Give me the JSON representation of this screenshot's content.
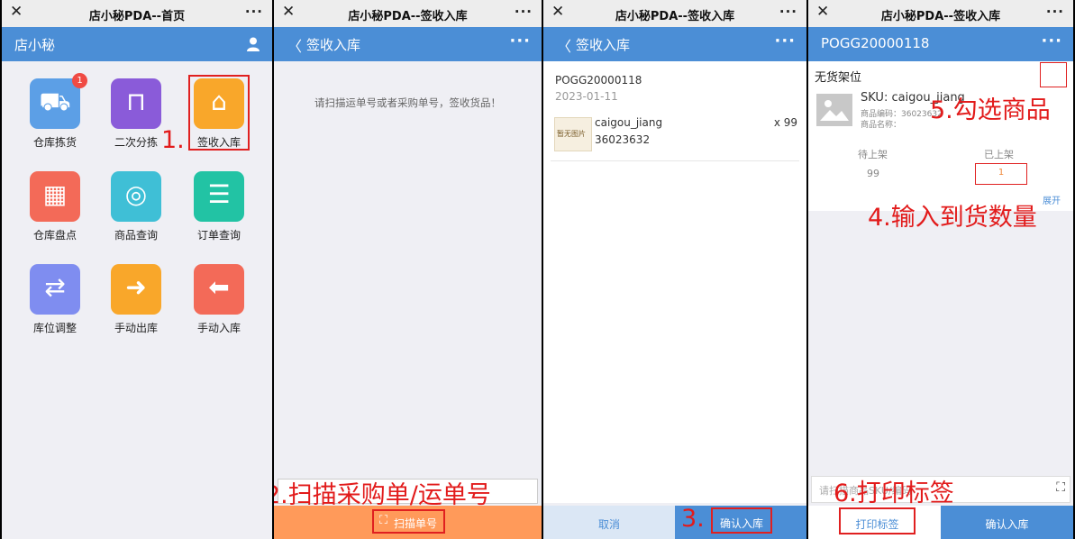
{
  "wechat": {
    "close_glyph": "✕",
    "more_glyph": "···"
  },
  "panel1": {
    "wechat_title": "店小秘PDA--首页",
    "header_title": "店小秘",
    "apps": [
      {
        "label": "仓库拣货",
        "icon": "cart-icon",
        "color": "#5c9fe6",
        "badge": "1",
        "glyph": "⛟"
      },
      {
        "label": "二次分拣",
        "icon": "sort-doc-icon",
        "color": "#8a5bd9",
        "glyph": "⊓"
      },
      {
        "label": "签收入库",
        "icon": "house-in-icon",
        "color": "#f9a72a",
        "glyph": "⌂"
      },
      {
        "label": "仓库盘点",
        "icon": "calculator-icon",
        "color": "#f36a58",
        "glyph": "▦"
      },
      {
        "label": "商品查询",
        "icon": "search-box-icon",
        "color": "#3fbfd6",
        "glyph": "◎"
      },
      {
        "label": "订单查询",
        "icon": "order-doc-icon",
        "color": "#22c3a4",
        "glyph": "☰"
      },
      {
        "label": "库位调整",
        "icon": "swap-icon",
        "color": "#7f8df0",
        "glyph": "⇄"
      },
      {
        "label": "手动出库",
        "icon": "scanner-out-icon",
        "color": "#f9a72a",
        "glyph": "➜"
      },
      {
        "label": "手动入库",
        "icon": "scanner-in-icon",
        "color": "#f36a58",
        "glyph": "⬅"
      }
    ],
    "annotation": "1."
  },
  "panel2": {
    "wechat_title": "店小秘PDA--签收入库",
    "header_title": "签收入库",
    "hint": "请扫描运单号或者采购单号，签收货品！",
    "scan_button": "扫描单号",
    "annotation": "2.扫描采购单/运单号"
  },
  "panel3": {
    "wechat_title": "店小秘PDA--签收入库",
    "header_title": "签收入库",
    "po_number": "POGG20000118",
    "date": "2023-01-11",
    "item": {
      "name": "caigou_jiang",
      "code": "36023632",
      "qty": "x 99",
      "thumb_text": "暂无图片"
    },
    "cancel_button": "取消",
    "confirm_button": "确认入库",
    "annotation": "3."
  },
  "panel4": {
    "wechat_title": "店小秘PDA--签收入库",
    "header_title": "POGG20000118",
    "section_title": "无货架位",
    "sku_line": "SKU: caigou_jiang",
    "code_line": "商品编码：36023632",
    "name_line": "商品名称：",
    "col_pending": "待上架",
    "col_done": "已上架",
    "pending_value": "99",
    "done_value": "1",
    "expand": "展开",
    "input_placeholder": "请扫描商品SKU/编码",
    "print_button": "打印标签",
    "confirm_button": "确认入库",
    "annotation_check": "5.勾选商品",
    "annotation_qty": "4.输入到货数量",
    "annotation_print": "6.打印标签"
  },
  "colors": {
    "blue": "#4b8ed6",
    "orange": "#ff9a5a",
    "annot_red": "#e21b1b"
  }
}
